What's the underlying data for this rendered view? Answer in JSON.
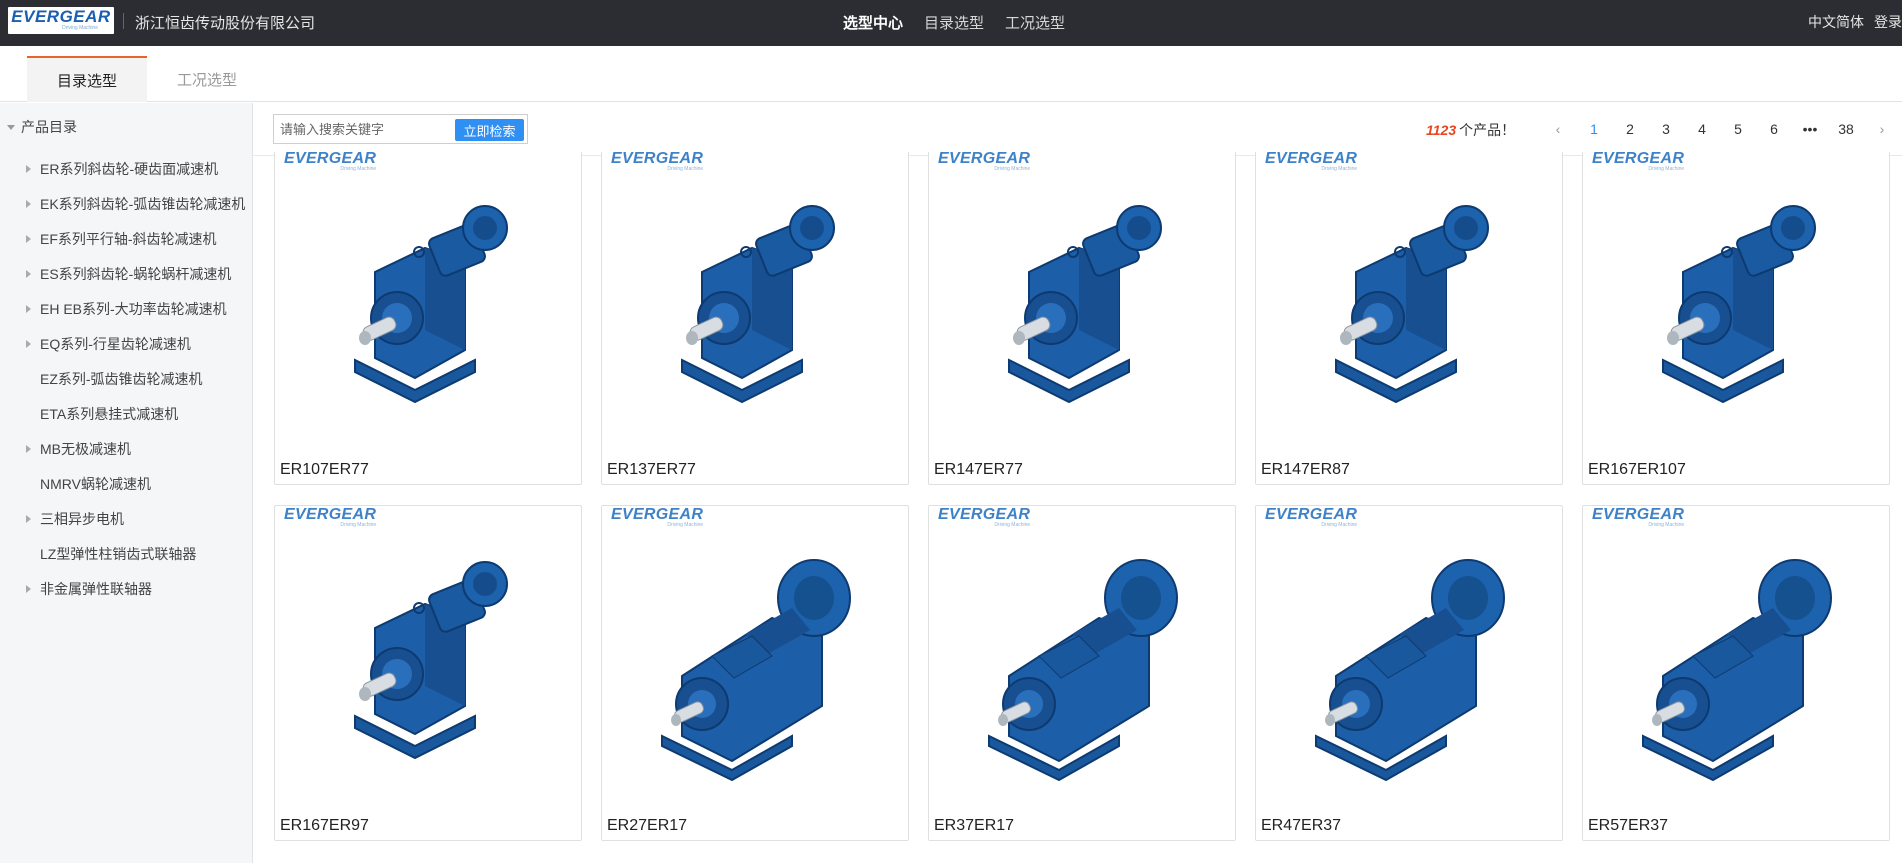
{
  "header": {
    "logo_text": "EVERGEAR",
    "logo_sub": "Driving Machine",
    "company": "浙江恒齿传动股份有限公司",
    "nav": [
      {
        "label": "选型中心",
        "active": true
      },
      {
        "label": "目录选型",
        "active": false
      },
      {
        "label": "工况选型",
        "active": false
      }
    ],
    "language": "中文简体",
    "login": "登录"
  },
  "tabs": [
    {
      "label": "目录选型",
      "active": true
    },
    {
      "label": "工况选型",
      "active": false
    }
  ],
  "sidebar": {
    "root": "产品目录",
    "items": [
      {
        "label": "ER系列斜齿轮-硬齿面减速机",
        "expandable": true
      },
      {
        "label": "EK系列斜齿轮-弧齿锥齿轮减速机",
        "expandable": true
      },
      {
        "label": "EF系列平行轴-斜齿轮减速机",
        "expandable": true
      },
      {
        "label": "ES系列斜齿轮-蜗轮蜗杆减速机",
        "expandable": true
      },
      {
        "label": "EH EB系列-大功率齿轮减速机",
        "expandable": true
      },
      {
        "label": "EQ系列-行星齿轮减速机",
        "expandable": true
      },
      {
        "label": "EZ系列-弧齿锥齿轮减速机",
        "expandable": false
      },
      {
        "label": "ETA系列悬挂式减速机",
        "expandable": false
      },
      {
        "label": "MB无极减速机",
        "expandable": true
      },
      {
        "label": "NMRV蜗轮减速机",
        "expandable": false
      },
      {
        "label": "三相异步电机",
        "expandable": true
      },
      {
        "label": "LZ型弹性柱销齿式联轴器",
        "expandable": false
      },
      {
        "label": "非金属弹性联轴器",
        "expandable": true
      }
    ]
  },
  "search": {
    "placeholder": "请输入搜索关键字",
    "value": "",
    "button": "立即检索"
  },
  "results": {
    "count": "1123",
    "suffix": "个产品！"
  },
  "pagination": {
    "prev": "‹",
    "pages": [
      "1",
      "2",
      "3",
      "4",
      "5",
      "6",
      "•••",
      "38"
    ],
    "current": "1",
    "next": "›"
  },
  "products": [
    {
      "name": "ER107ER77",
      "style": "compact"
    },
    {
      "name": "ER137ER77",
      "style": "compact"
    },
    {
      "name": "ER147ER77",
      "style": "compact"
    },
    {
      "name": "ER147ER87",
      "style": "compact"
    },
    {
      "name": "ER167ER107",
      "style": "compact"
    },
    {
      "name": "ER167ER97",
      "style": "compact"
    },
    {
      "name": "ER27ER17",
      "style": "long"
    },
    {
      "name": "ER37ER17",
      "style": "long"
    },
    {
      "name": "ER47ER37",
      "style": "long"
    },
    {
      "name": "ER57ER37",
      "style": "long"
    }
  ],
  "colors": {
    "topbar": "#2b2d33",
    "accent_tab": "#e8632a",
    "primary": "#2f8ff3",
    "count": "#e8461e",
    "gearbox": "#1d5ea8"
  }
}
